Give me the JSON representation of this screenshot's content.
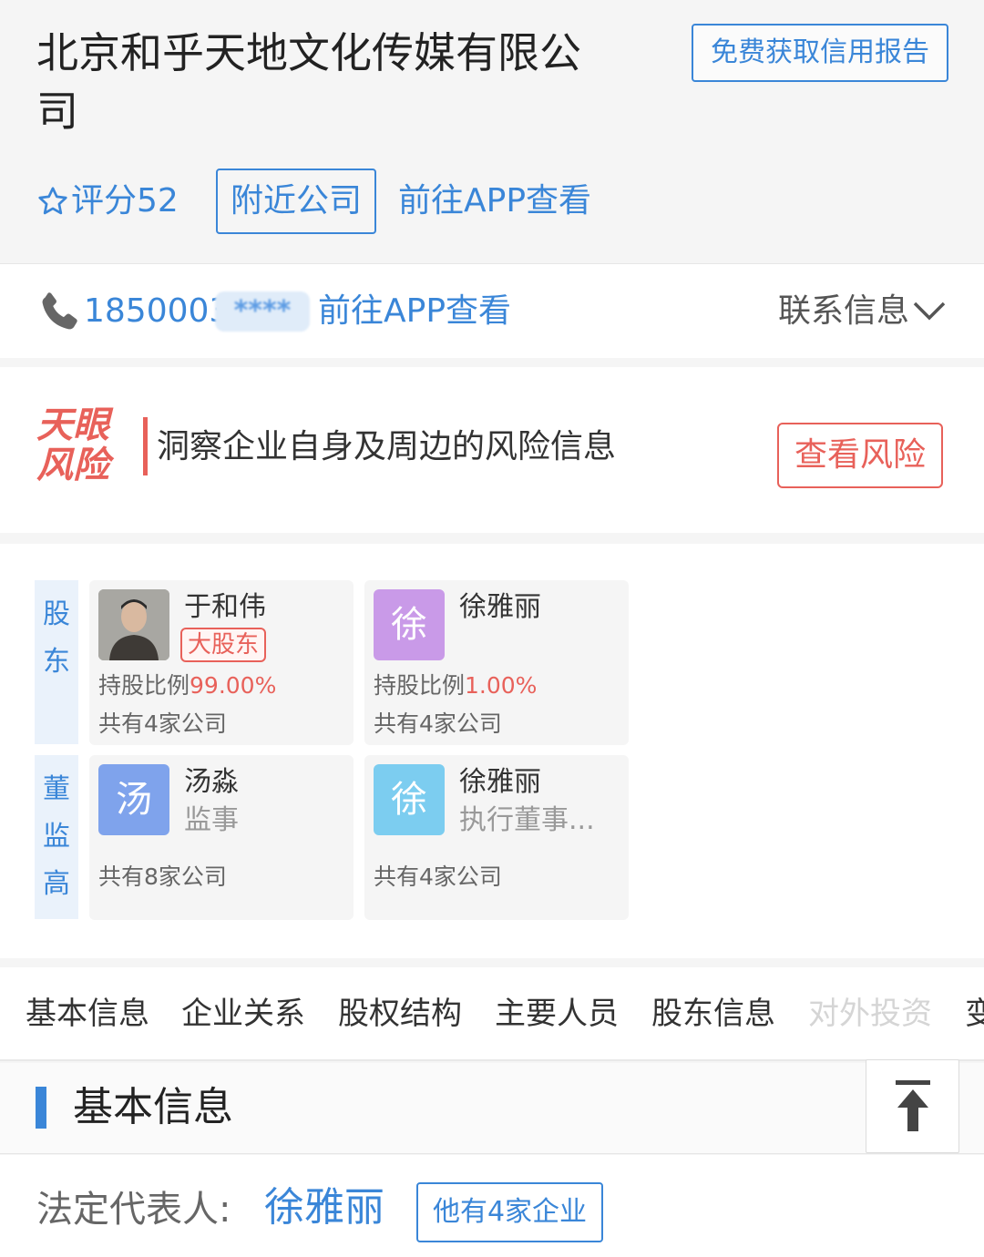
{
  "company": {
    "name": "北京和乎天地文化传媒有限公司",
    "credit_report_label": "免费获取信用报告",
    "score_label": "评分52",
    "nearby_label": "附近公司",
    "app_link_label": "前往APP查看"
  },
  "contact": {
    "phone_prefix": "1850003",
    "phone_mask": "****",
    "app_link_label": "前往APP查看",
    "contact_info_label": "联系信息"
  },
  "risk": {
    "logo_line1": "天眼",
    "logo_line2": "风险",
    "description": "洞察企业自身及周边的风险信息",
    "button_label": "查看风险"
  },
  "shareholders": {
    "tag_chars": [
      "股",
      "东"
    ],
    "cards": [
      {
        "name": "于和伟",
        "badge": "大股东",
        "ratio_label": "持股比例",
        "ratio_value": "99.00%",
        "company_count": "共有4家公司"
      },
      {
        "name": "徐雅丽",
        "avatar_char": "徐",
        "ratio_label": "持股比例",
        "ratio_value": "1.00%",
        "company_count": "共有4家公司"
      }
    ]
  },
  "executives": {
    "tag_chars": [
      "董",
      "监",
      "高"
    ],
    "cards": [
      {
        "name": "汤淼",
        "avatar_char": "汤",
        "role": "监事",
        "company_count": "共有8家公司"
      },
      {
        "name": "徐雅丽",
        "avatar_char": "徐",
        "role": "执行董事...",
        "company_count": "共有4家公司"
      }
    ]
  },
  "tabs": [
    "基本信息",
    "企业关系",
    "股权结构",
    "主要人员",
    "股东信息",
    "对外投资",
    "变"
  ],
  "basic_info": {
    "section_title": "基本信息",
    "legal_rep_label": "法定代表人:",
    "legal_rep_name": "徐雅丽",
    "legal_rep_companies": "他有4家企业"
  },
  "colors": {
    "primary_blue": "#3a86d8",
    "risk_red": "#e8615a",
    "avatar_purple": "#c99ae8",
    "avatar_blue": "#7fa3ec",
    "avatar_cyan": "#7ccdf0"
  }
}
